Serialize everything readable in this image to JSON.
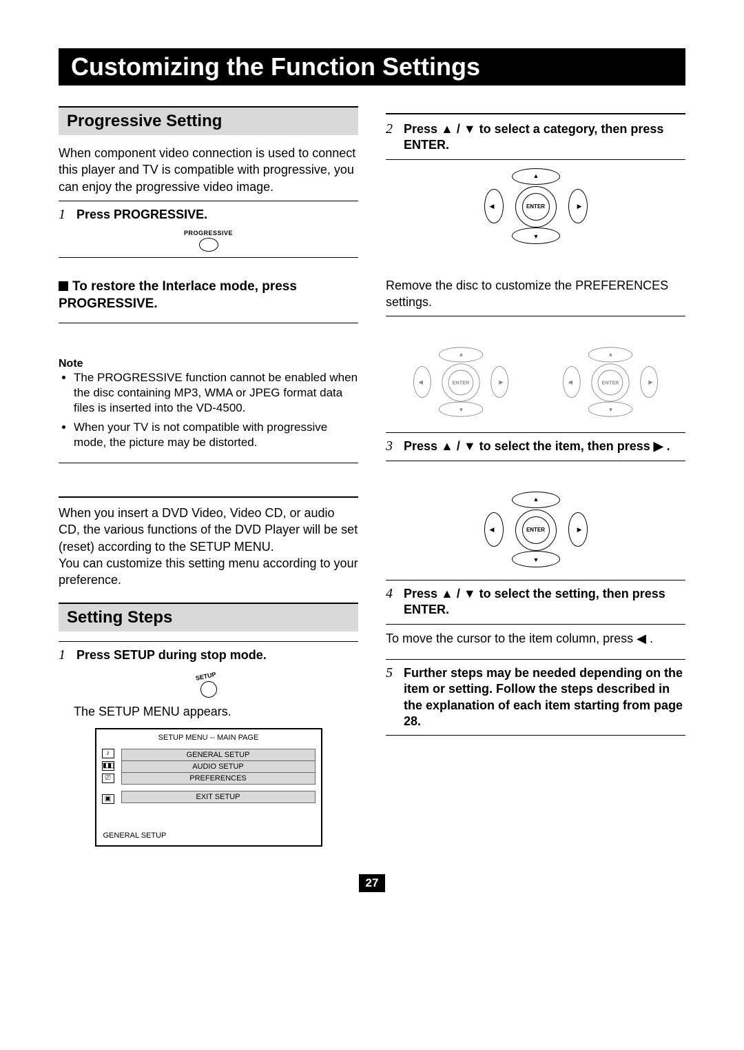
{
  "page_number": "27",
  "title": "Customizing the Function Settings",
  "left": {
    "section1_title": "Progressive Setting",
    "intro": "When component video connection is used to connect this player and TV is compatible with progressive, you can enjoy the progressive video image.",
    "step1_num": "1",
    "step1_text_a": "Press ",
    "step1_text_b": "PROGRESSIVE.",
    "progressive_label": "PROGRESSIVE",
    "restore": "To restore the Interlace mode, press PROGRESSIVE.",
    "note_head": "Note",
    "note1": "The PROGRESSIVE function cannot be enabled when the disc containing MP3, WMA or JPEG format data files is inserted into the VD-4500.",
    "note2": "When your TV is not compatible with progressive mode, the picture may be distorted.",
    "dvd_para": "When you insert a DVD Video, Video CD, or audio CD, the various functions of the DVD Player will be set (reset) according to the SETUP MENU.\nYou can customize this setting menu according to your preference.",
    "section2_title": "Setting Steps",
    "ss_step1_num": "1",
    "ss_step1_text": "Press SETUP during stop mode.",
    "setup_label": "SETUP",
    "ss_followup": "The SETUP MENU appears.",
    "menu": {
      "title": "SETUP MENU -- MAIN PAGE",
      "items": [
        "GENERAL SETUP",
        "AUDIO SETUP",
        "PREFERENCES"
      ],
      "exit": "EXIT SETUP",
      "footer": "GENERAL SETUP"
    }
  },
  "right": {
    "step2_num": "2",
    "step2_text": "Press ▲ / ▼ to select a category, then press ENTER.",
    "enter_label": "ENTER",
    "remove_para": "Remove the disc to customize the PREFERENCES settings.",
    "step3_num": "3",
    "step3_text": "Press ▲ / ▼ to select the item, then press ▶ .",
    "step4_num": "4",
    "step4_text": "Press ▲ / ▼ to select the setting, then press ENTER.",
    "step4_follow": "To move the cursor to the item column, press ◀ .",
    "step5_num": "5",
    "step5_text": "Further steps may be needed depending on the item or setting. Follow the steps described in the explanation of each item starting from page 28."
  }
}
